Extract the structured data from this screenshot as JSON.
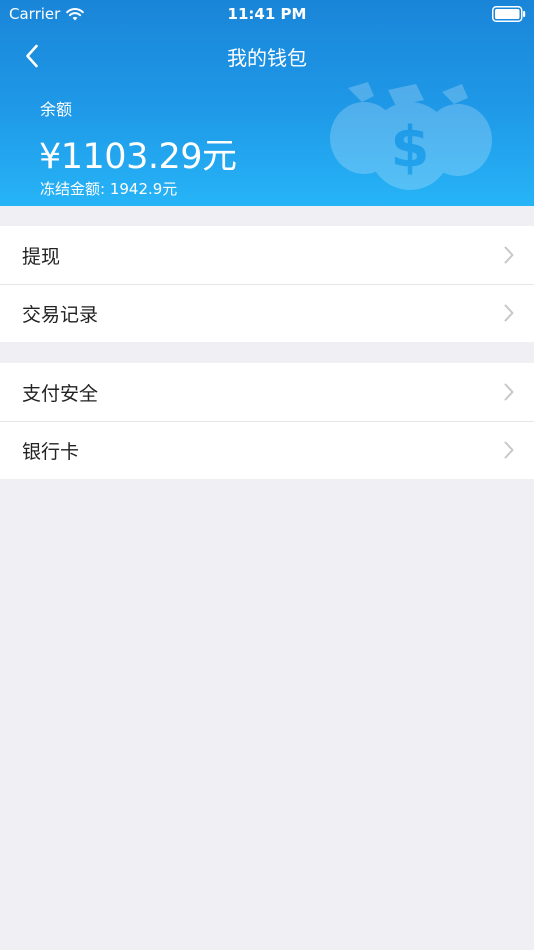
{
  "status_bar": {
    "carrier": "Carrier",
    "time": "11:41 PM"
  },
  "nav": {
    "title": "我的钱包",
    "back_icon": "chevron-left-icon"
  },
  "wallet": {
    "balance_label": "余额",
    "balance": "¥1103.29元",
    "frozen": "冻结金额: 1942.9元",
    "illustration_icon": "money-bags-icon"
  },
  "menu": {
    "group1": [
      {
        "label": "提现"
      },
      {
        "label": "交易记录"
      }
    ],
    "group2": [
      {
        "label": "支付安全"
      },
      {
        "label": "银行卡"
      }
    ]
  },
  "colors": {
    "header_top": "#1a85d8",
    "header_bottom": "#27b4f7",
    "background": "#efeff4",
    "chevron": "#c7c7cc"
  }
}
